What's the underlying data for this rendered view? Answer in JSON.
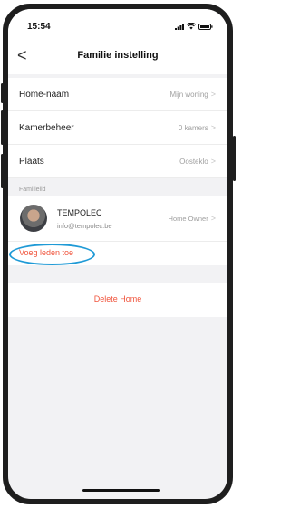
{
  "status_bar": {
    "time": "15:54"
  },
  "header": {
    "back_label": "<",
    "title": "Familie instelling"
  },
  "settings": [
    {
      "label": "Home-naam",
      "value": "Mijn woning"
    },
    {
      "label": "Kamerbeheer",
      "value": "0 kamers"
    },
    {
      "label": "Plaats",
      "value": "Oosteklo"
    }
  ],
  "members_section": {
    "header": "Familielid",
    "members": [
      {
        "name": "TEMPOLEC",
        "email": "info@tempolec.be",
        "role": "Home Owner"
      }
    ],
    "add_label": "Voeg leden toe"
  },
  "delete_label": "Delete Home",
  "colors": {
    "accent": "#f0543c",
    "highlight": "#1f9ad6",
    "background": "#f2f2f4"
  }
}
